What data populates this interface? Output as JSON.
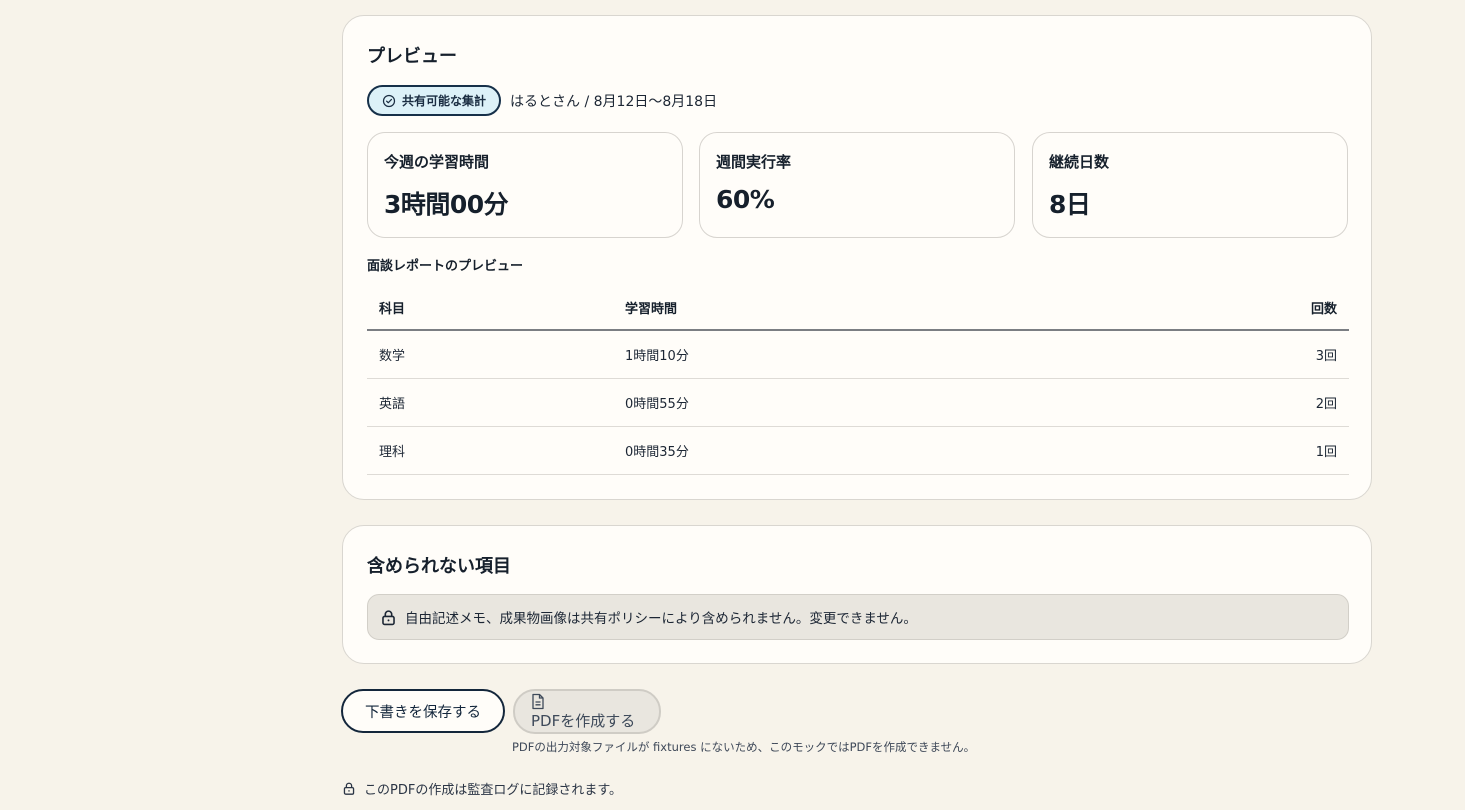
{
  "preview": {
    "title": "プレビュー",
    "badge_label": "共有可能な集計",
    "meta": "はるとさん / 8月12日〜8月18日",
    "stats": [
      {
        "label": "今週の学習時間",
        "value": "3時間00分"
      },
      {
        "label": "週間実行率",
        "value": "60%"
      },
      {
        "label": "継続日数",
        "value": "8日"
      }
    ],
    "table_title": "面談レポートのプレビュー",
    "table": {
      "headers": [
        "科目",
        "学習時間",
        "回数"
      ],
      "rows": [
        [
          "数学",
          "1時間10分",
          "3回"
        ],
        [
          "英語",
          "0時間55分",
          "2回"
        ],
        [
          "理科",
          "0時間35分",
          "1回"
        ]
      ]
    }
  },
  "excluded": {
    "title": "含められない項目",
    "notice": "自由記述メモ、成果物画像は共有ポリシーにより含められません。変更できません。"
  },
  "actions": {
    "save_draft": "下書きを保存する",
    "create_pdf": "PDFを作成する",
    "pdf_hint": "PDFの出力対象ファイルが fixtures にないため、このモックではPDFを作成できません。",
    "audit_note": "このPDFの作成は監査ログに記録されます。"
  }
}
